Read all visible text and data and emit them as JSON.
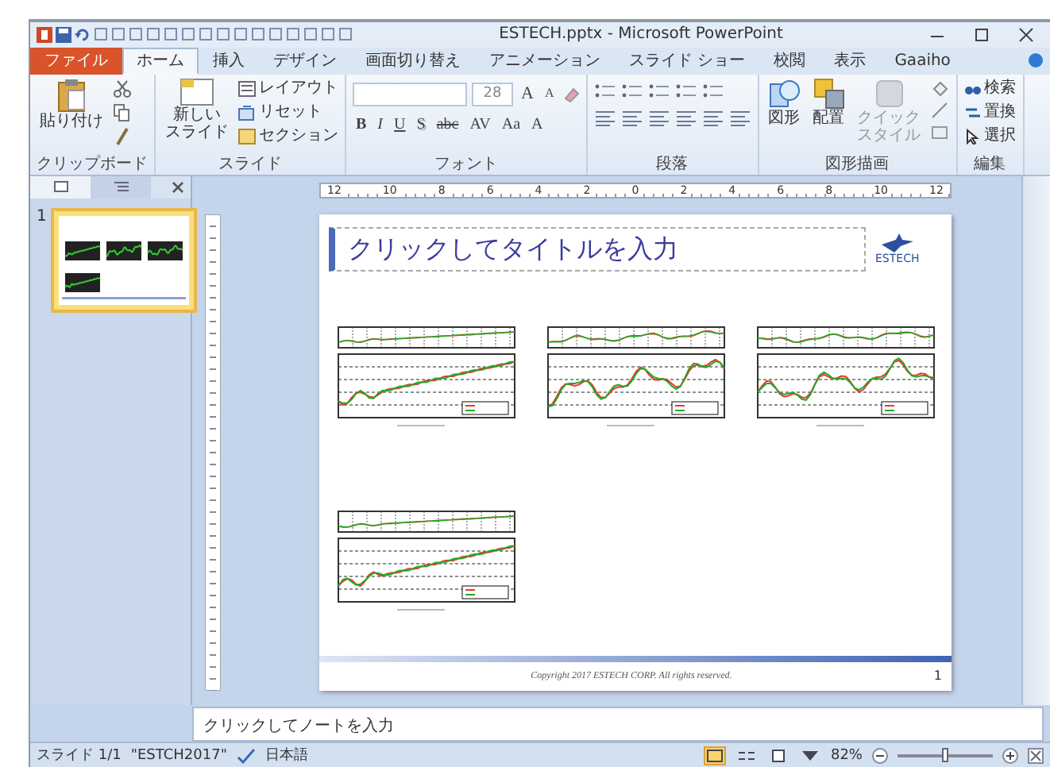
{
  "window": {
    "title": "ESTECH.pptx - Microsoft PowerPoint"
  },
  "ribbon_tabs": [
    {
      "label": "ファイル",
      "kind": "file",
      "selected": false
    },
    {
      "label": "ホーム",
      "kind": "tab",
      "selected": true
    },
    {
      "label": "挿入",
      "kind": "tab",
      "selected": false
    },
    {
      "label": "デザイン",
      "kind": "tab",
      "selected": false
    },
    {
      "label": "画面切り替え",
      "kind": "tab",
      "selected": false
    },
    {
      "label": "アニメーション",
      "kind": "tab",
      "selected": false
    },
    {
      "label": "スライド ショー",
      "kind": "tab",
      "selected": false
    },
    {
      "label": "校閲",
      "kind": "tab",
      "selected": false
    },
    {
      "label": "表示",
      "kind": "tab",
      "selected": false
    },
    {
      "label": "Gaaiho",
      "kind": "tab",
      "selected": false
    }
  ],
  "ribbon": {
    "clipboard": {
      "paste": "貼り付け",
      "group": "クリップボード"
    },
    "slides": {
      "new_slide": [
        "新しい",
        "スライド"
      ],
      "layout": "レイアウト",
      "reset": "リセット",
      "section": "セクション",
      "group": "スライド"
    },
    "font": {
      "size": "28",
      "sizing": [
        "A",
        "A"
      ],
      "buttons": [
        "B",
        "I",
        "U",
        "S",
        "abc",
        "AV",
        "Aa",
        "A"
      ],
      "group": "フォント"
    },
    "paragraph": {
      "group": "段落"
    },
    "drawing": {
      "shapes": "図形",
      "arrange": "配置",
      "quick_styles": [
        "クイック",
        "スタイル"
      ],
      "group": "図形描画"
    },
    "editing": {
      "find": "検索",
      "replace": "置換",
      "select": "選択",
      "group": "編集"
    }
  },
  "ruler": {
    "labels": [
      "12",
      "10",
      "8",
      "6",
      "4",
      "2",
      "0",
      "2",
      "4",
      "6",
      "8",
      "10",
      "12"
    ]
  },
  "pane_tabs": [
    {
      "kind": "slides",
      "selected": true
    },
    {
      "kind": "outline",
      "selected": false
    }
  ],
  "thumbnails": [
    {
      "number": "1",
      "selected": true
    }
  ],
  "slide": {
    "title_placeholder": "クリックしてタイトルを入力",
    "logo": "ESTECH",
    "charts": [
      {
        "kind": "trend"
      },
      {
        "kind": "volatile"
      },
      {
        "kind": "volatile"
      },
      {
        "kind": "trend"
      }
    ],
    "footer": "Copyright 2017 ESTECH CORP. All rights reserved.",
    "page_number": "1"
  },
  "notes": {
    "prompt": "クリックしてノートを入力"
  },
  "status_bar": {
    "slide": "スライド 1/1",
    "theme": "\"ESTCH2017\"",
    "language": "日本語",
    "views": [
      {
        "kind": "normal",
        "selected": true
      },
      {
        "kind": "sorter",
        "selected": false
      },
      {
        "kind": "reading",
        "selected": false
      },
      {
        "kind": "show",
        "selected": false
      }
    ],
    "zoom": "82%",
    "zoom_slider": {
      "level": 0.5
    }
  }
}
